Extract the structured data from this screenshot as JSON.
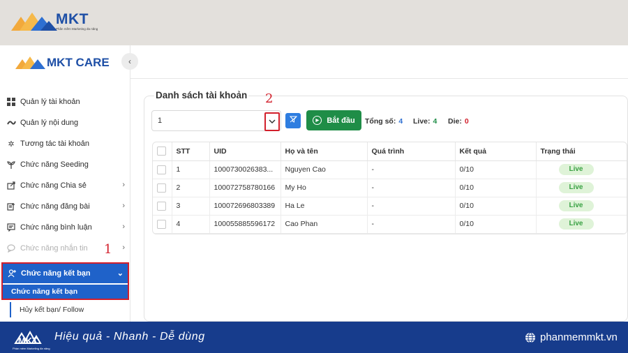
{
  "brand": {
    "name": "MKT",
    "tagline": "Phần mềm Marketing đa năng",
    "colors": {
      "primary_blue": "#1e4fa6",
      "accent_orange": "#f2a93b",
      "banner": "#173c8c"
    }
  },
  "sidebar": {
    "app_name": "MKT CARE",
    "collapse_icon": "chevron-left-icon",
    "items": [
      {
        "label": "Quản lý tài khoản",
        "icon": "grid-icon"
      },
      {
        "label": "Quản lý nội dung",
        "icon": "content-icon"
      },
      {
        "label": "Tương tác tài khoản",
        "icon": "sparkle-icon"
      },
      {
        "label": "Chức năng Seeding",
        "icon": "seedling-icon"
      },
      {
        "label": "Chức năng Chia sẻ",
        "icon": "share-icon"
      },
      {
        "label": "Chức năng đăng bài",
        "icon": "post-icon"
      },
      {
        "label": "Chức năng bình luận",
        "icon": "comment-icon"
      },
      {
        "label": "Chức năng nhắn tin",
        "icon": "chat-icon"
      }
    ],
    "active_group": {
      "label": "Chức năng kết bạn",
      "icon": "add-friend-icon"
    },
    "sub_items": [
      "Chức năng kết bạn",
      "Hủy kết bạn/ Follow"
    ],
    "annotation_1": "1"
  },
  "panel": {
    "title": "Danh sách tài khoản",
    "select_value": "1",
    "annotation_2": "2",
    "start_label": "Bắt đầu",
    "stats": {
      "total_label": "Tổng số:",
      "total_value": "4",
      "live_label": "Live:",
      "live_value": "4",
      "die_label": "Die:",
      "die_value": "0"
    }
  },
  "table": {
    "headers": {
      "stt": "STT",
      "uid": "UID",
      "name": "Họ và tên",
      "process": "Quá trình",
      "result": "Kết quả",
      "status": "Trạng thái"
    },
    "rows": [
      {
        "stt": "1",
        "uid": "1000730026383...",
        "name": "Nguyen Cao",
        "process": "-",
        "result": "0/10",
        "status": "Live"
      },
      {
        "stt": "2",
        "uid": "100072758780166",
        "name": "My Ho",
        "process": "-",
        "result": "0/10",
        "status": "Live"
      },
      {
        "stt": "3",
        "uid": "100072696803389",
        "name": "Ha Le",
        "process": "-",
        "result": "0/10",
        "status": "Live"
      },
      {
        "stt": "4",
        "uid": "100055885596172",
        "name": "Cao Phan",
        "process": "-",
        "result": "0/10",
        "status": "Live"
      }
    ]
  },
  "banner": {
    "slogan": "Hiệu quả - Nhanh  - Dễ dùng",
    "website": "phanmemmkt.vn"
  }
}
